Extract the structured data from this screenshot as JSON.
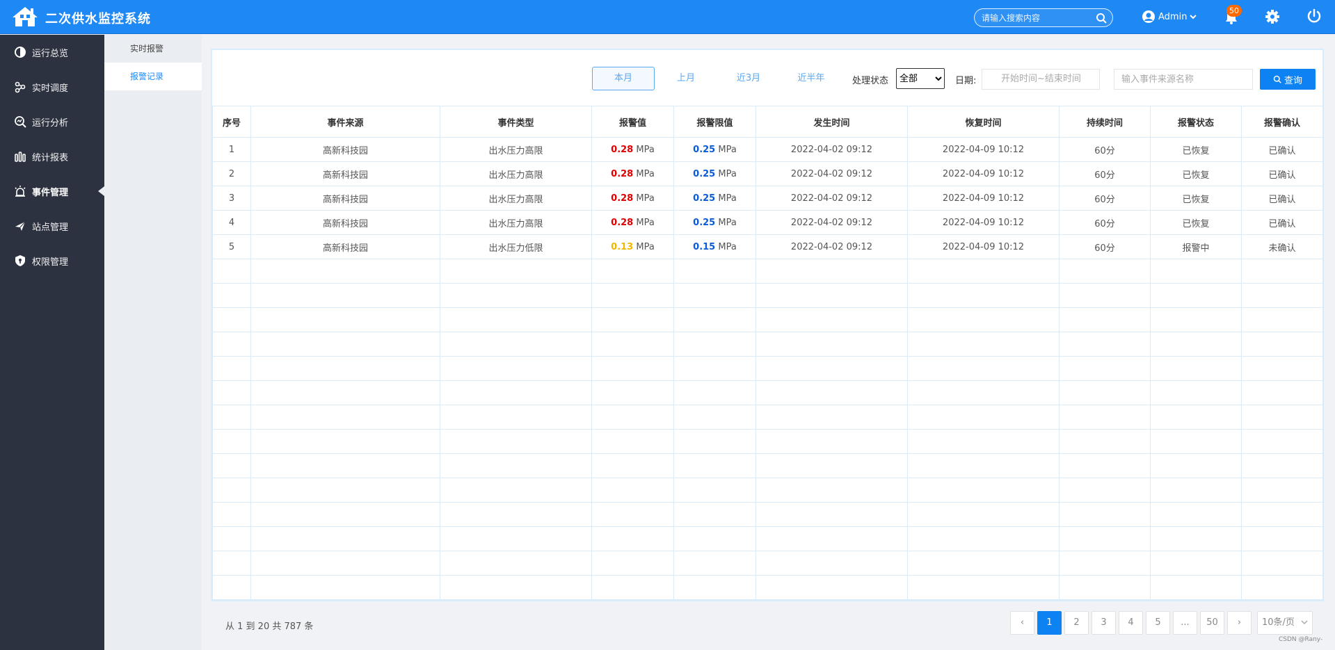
{
  "app": {
    "title": "二次供水监控系统"
  },
  "header": {
    "search_placeholder": "请输入搜索内容",
    "user_name": "Admin",
    "notification_count": "50",
    "icons": [
      "home-logo-icon",
      "search-icon",
      "user-icon",
      "chevron-down-icon",
      "bell-icon",
      "gear-icon",
      "power-icon"
    ]
  },
  "sidebar": {
    "items": [
      {
        "label": "运行总览",
        "icon": "overview-icon",
        "active": false
      },
      {
        "label": "实时调度",
        "icon": "dispatch-icon",
        "active": false
      },
      {
        "label": "运行分析",
        "icon": "analysis-icon",
        "active": false
      },
      {
        "label": "统计报表",
        "icon": "report-icon",
        "active": false
      },
      {
        "label": "事件管理",
        "icon": "alarm-icon",
        "active": true
      },
      {
        "label": "站点管理",
        "icon": "station-icon",
        "active": false
      },
      {
        "label": "权限管理",
        "icon": "shield-icon",
        "active": false
      }
    ]
  },
  "subnav": {
    "items": [
      {
        "label": "实时报警",
        "active": false
      },
      {
        "label": "报警记录",
        "active": true
      }
    ]
  },
  "filters": {
    "tabs": [
      {
        "label": "本月",
        "active": true
      },
      {
        "label": "上月",
        "active": false
      },
      {
        "label": "近3月",
        "active": false
      },
      {
        "label": "近半年",
        "active": false
      }
    ],
    "status_label": "处理状态",
    "status_value": "全部",
    "date_label": "日期:",
    "date_placeholder": "开始时间~结束时间",
    "source_placeholder": "输入事件来源名称",
    "query_label": "查询",
    "query_icon": "search-icon"
  },
  "table": {
    "columns": [
      "序号",
      "事件来源",
      "事件类型",
      "报警值",
      "报警限值",
      "发生时间",
      "恢复时间",
      "持续时间",
      "报警状态",
      "报警确认"
    ],
    "rows": [
      {
        "no": "1",
        "source": "高新科技园",
        "type": "出水压力高限",
        "alarm_value": "0.28",
        "alarm_color": "red",
        "limit": "0.25",
        "unit": "MPa",
        "start": "2022-04-02 09:12",
        "recover": "2022-04-09 10:12",
        "duration": "60分",
        "status": "已恢复",
        "confirm": "已确认"
      },
      {
        "no": "2",
        "source": "高新科技园",
        "type": "出水压力高限",
        "alarm_value": "0.28",
        "alarm_color": "red",
        "limit": "0.25",
        "unit": "MPa",
        "start": "2022-04-02 09:12",
        "recover": "2022-04-09 10:12",
        "duration": "60分",
        "status": "已恢复",
        "confirm": "已确认"
      },
      {
        "no": "3",
        "source": "高新科技园",
        "type": "出水压力高限",
        "alarm_value": "0.28",
        "alarm_color": "red",
        "limit": "0.25",
        "unit": "MPa",
        "start": "2022-04-02 09:12",
        "recover": "2022-04-09 10:12",
        "duration": "60分",
        "status": "已恢复",
        "confirm": "已确认"
      },
      {
        "no": "4",
        "source": "高新科技园",
        "type": "出水压力高限",
        "alarm_value": "0.28",
        "alarm_color": "red",
        "limit": "0.25",
        "unit": "MPa",
        "start": "2022-04-02 09:12",
        "recover": "2022-04-09 10:12",
        "duration": "60分",
        "status": "已恢复",
        "confirm": "已确认"
      },
      {
        "no": "5",
        "source": "高新科技园",
        "type": "出水压力低限",
        "alarm_value": "0.13",
        "alarm_color": "yellow",
        "limit": "0.15",
        "unit": "MPa",
        "start": "2022-04-02 09:12",
        "recover": "2022-04-09 10:12",
        "duration": "60分",
        "status": "报警中",
        "confirm": "未确认"
      }
    ],
    "empty_rows": 14
  },
  "footer": {
    "summary": "从 1 到 20 共 787 条",
    "prev": "‹",
    "next": "›",
    "pages": [
      {
        "label": "1",
        "active": true
      },
      {
        "label": "2",
        "active": false
      },
      {
        "label": "3",
        "active": false
      },
      {
        "label": "4",
        "active": false
      },
      {
        "label": "5",
        "active": false
      },
      {
        "label": "...",
        "active": false
      },
      {
        "label": "50",
        "active": false
      }
    ],
    "page_size": "10条/页"
  },
  "watermark": "CSDN @Rany-",
  "colors": {
    "primary": "#1e88f5",
    "sidebar": "#2d3240",
    "alarm_red": "#e00000",
    "limit_blue": "#0a5bd8",
    "alarm_yellow": "#f0b800"
  }
}
